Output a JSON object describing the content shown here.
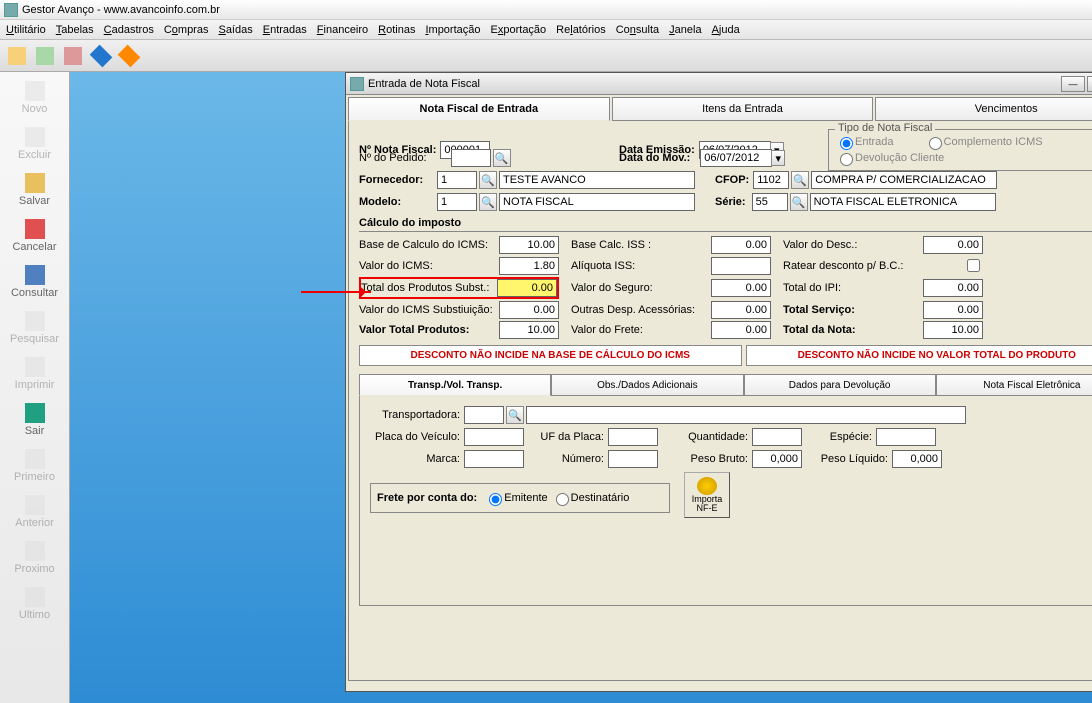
{
  "app_title": "Gestor Avanço - www.avancoinfo.com.br",
  "menu": [
    "Utilitário",
    "Tabelas",
    "Cadastros",
    "Compras",
    "Saídas",
    "Entradas",
    "Financeiro",
    "Rotinas",
    "Importação",
    "Exportação",
    "Relatórios",
    "Consulta",
    "Janela",
    "Ajuda"
  ],
  "left_buttons": [
    {
      "label": "Novo",
      "dim": true
    },
    {
      "label": "Excluir",
      "dim": true
    },
    {
      "label": "Salvar",
      "dim": false
    },
    {
      "label": "Cancelar",
      "dim": false
    },
    {
      "label": "Consultar",
      "dim": false
    },
    {
      "label": "Pesquisar",
      "dim": true
    },
    {
      "label": "Imprimir",
      "dim": true
    },
    {
      "label": "Sair",
      "dim": false
    },
    {
      "label": "Primeiro",
      "dim": true
    },
    {
      "label": "Anterior",
      "dim": true
    },
    {
      "label": "Proximo",
      "dim": true
    },
    {
      "label": "Ultimo",
      "dim": true
    }
  ],
  "modal_title": "Entrada de Nota Fiscal",
  "big_tabs": [
    "Nota Fiscal de Entrada",
    "Itens da Entrada",
    "Vencimentos"
  ],
  "header": {
    "num_nota_label": "Nº Nota Fiscal:",
    "num_nota": "000001",
    "data_emissao_label": "Data Emissão:",
    "data_emissao": "06/07/2012",
    "num_pedido_label": "Nº do Pedido:",
    "num_pedido": "",
    "data_mov_label": "Data do Mov.:",
    "data_mov": "06/07/2012",
    "fornecedor_label": "Fornecedor:",
    "fornecedor_code": "1",
    "fornecedor_name": "TESTE AVANCO",
    "modelo_label": "Modelo:",
    "modelo_code": "1",
    "modelo_name": "NOTA FISCAL",
    "cfop_label": "CFOP:",
    "cfop_code": "1102",
    "cfop_name": "COMPRA P/ COMERCIALIZACAO",
    "serie_label": "Série:",
    "serie_code": "55",
    "serie_name": "NOTA FISCAL ELETRONICA",
    "tipo_title": "Tipo de Nota Fiscal",
    "tipo_entrada": "Entrada",
    "tipo_complemento": "Complemento ICMS",
    "tipo_devolucao": "Devolução Cliente"
  },
  "calc": {
    "title": "Cálculo do imposto",
    "rows": [
      {
        "l": "Base de Calculo do ICMS:",
        "v": "10.00"
      },
      {
        "l": "Base Calc. ISS :",
        "v": "0.00"
      },
      {
        "l": "Valor do Desc.:",
        "v": "0.00"
      },
      {
        "l": "Valor do ICMS:",
        "v": "1.80"
      },
      {
        "l": "Alíquota ISS:",
        "v": ""
      },
      {
        "l": "Ratear desconto p/ B.C.:",
        "v": "",
        "chk": true
      },
      {
        "l": "Total dos Produtos Subst.:",
        "v": "0.00",
        "hl": true
      },
      {
        "l": "Valor do Seguro:",
        "v": "0.00"
      },
      {
        "l": "Total do IPI:",
        "v": "0.00"
      },
      {
        "l": "Valor do ICMS Substiuição:",
        "v": "0.00"
      },
      {
        "l": "Outras Desp. Acessórias:",
        "v": "0.00"
      },
      {
        "l": "Total Serviço:",
        "v": "0.00",
        "b": true
      },
      {
        "l": "Valor Total Produtos:",
        "v": "10.00",
        "b": true
      },
      {
        "l": "Valor do Frete:",
        "v": "0.00"
      },
      {
        "l": "Total da Nota:",
        "v": "10.00",
        "b": true
      }
    ]
  },
  "warn1": "DESCONTO NÃO INCIDE NA BASE DE CÁLCULO DO ICMS",
  "warn2": "DESCONTO NÃO INCIDE NO VALOR TOTAL DO PRODUTO",
  "sub_tabs": [
    "Transp./Vol. Transp.",
    "Obs./Dados Adicionais",
    "Dados para Devolução",
    "Nota Fiscal Eletrônica"
  ],
  "transp": {
    "transportadora_label": "Transportadora:",
    "transportadora": "",
    "placa_label": "Placa do Veículo:",
    "placa": "",
    "uf_label": "UF da Placa:",
    "uf": "",
    "qtd_label": "Quantidade:",
    "qtd": "",
    "especie_label": "Espécie:",
    "especie": "",
    "marca_label": "Marca:",
    "marca": "",
    "numero_label": "Número:",
    "numero": "",
    "peso_bruto_label": "Peso Bruto:",
    "peso_bruto": "0,000",
    "peso_liq_label": "Peso Líquido:",
    "peso_liq": "0,000",
    "frete_title": "Frete por conta do:",
    "emitente": "Emitente",
    "destinatario": "Destinatário",
    "import_btn": "Importa NF-E"
  }
}
